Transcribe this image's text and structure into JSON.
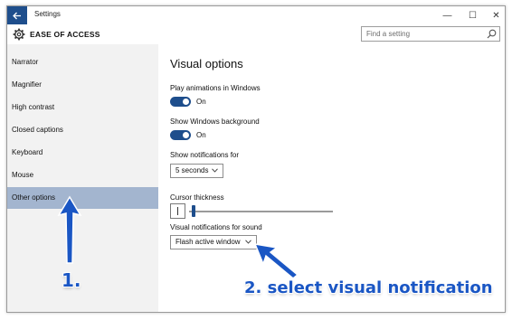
{
  "titlebar": {
    "title": "Settings",
    "min": "—",
    "max": "☐",
    "close": "✕"
  },
  "header": {
    "title": "EASE OF ACCESS",
    "search_placeholder": "Find a setting"
  },
  "sidebar": {
    "items": [
      {
        "label": "Narrator"
      },
      {
        "label": "Magnifier"
      },
      {
        "label": "High contrast"
      },
      {
        "label": "Closed captions"
      },
      {
        "label": "Keyboard"
      },
      {
        "label": "Mouse"
      },
      {
        "label": "Other options",
        "active": true
      }
    ]
  },
  "main": {
    "title": "Visual options",
    "play_animations": {
      "label": "Play animations in Windows",
      "state": "On"
    },
    "show_background": {
      "label": "Show Windows background",
      "state": "On"
    },
    "notifications": {
      "label": "Show notifications for",
      "value": "5 seconds"
    },
    "cursor": {
      "label": "Cursor thickness",
      "value": 1
    },
    "visual_notifications": {
      "label": "Visual notifications for sound",
      "value": "Flash active window"
    }
  },
  "annotations": {
    "step1": "1.",
    "step2": "2. select visual notification"
  },
  "colors": {
    "accent": "#1e4e8c",
    "selected": "#a3b5cf",
    "sidebar": "#f2f2f2",
    "annotation": "#1a56c4"
  },
  "icons": {
    "back": "back-arrow-icon",
    "header": "gear-icon",
    "search": "search-icon",
    "dropdown": "chevron-down-icon"
  }
}
